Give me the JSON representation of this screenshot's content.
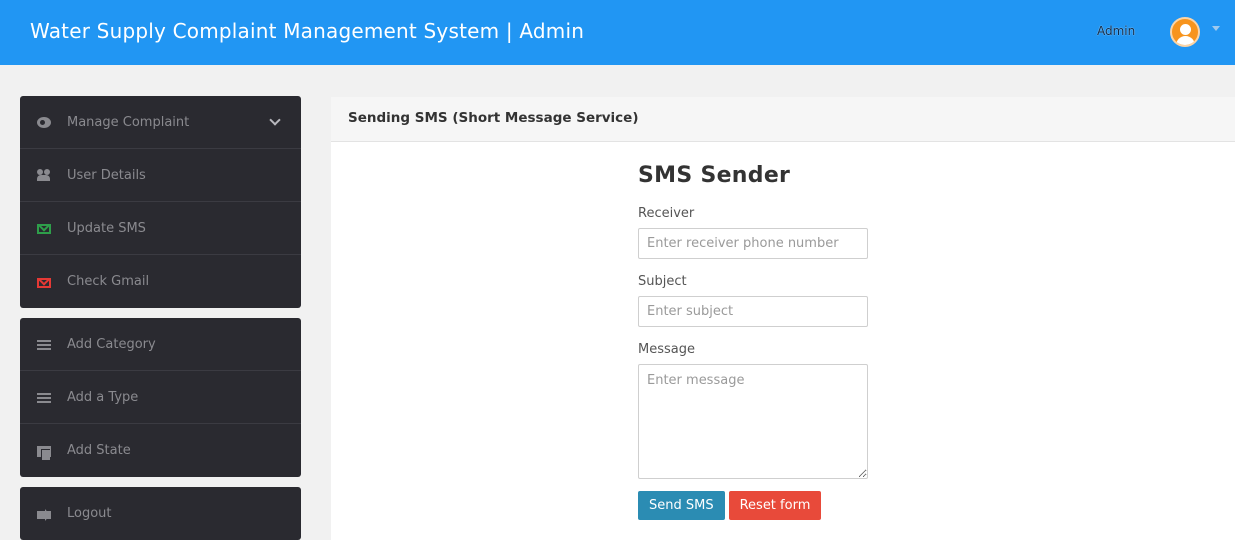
{
  "header": {
    "title": "Water Supply Complaint Management System | Admin",
    "user_label": "Admin"
  },
  "sidebar": {
    "groups": [
      {
        "items": [
          {
            "label": "Manage Complaint",
            "icon": "gear-icon",
            "has_dropdown": true
          },
          {
            "label": "User Details",
            "icon": "users-icon"
          },
          {
            "label": "Update SMS",
            "icon": "envelope-icon",
            "icon_color": "#2e9e4a"
          },
          {
            "label": "Check Gmail",
            "icon": "envelope-icon",
            "icon_color": "#e53935"
          }
        ]
      },
      {
        "items": [
          {
            "label": "Add Category",
            "icon": "list-icon"
          },
          {
            "label": "Add a Type",
            "icon": "list-icon"
          },
          {
            "label": "Add State",
            "icon": "copy-icon"
          }
        ]
      },
      {
        "items": [
          {
            "label": "Logout",
            "icon": "sign-out-icon"
          }
        ]
      }
    ]
  },
  "panel": {
    "heading": "Sending SMS (Short Message Service)"
  },
  "form": {
    "title": "SMS Sender",
    "receiver": {
      "label": "Receiver",
      "placeholder": "Enter receiver phone number",
      "value": ""
    },
    "subject": {
      "label": "Subject",
      "placeholder": "Enter subject",
      "value": ""
    },
    "message": {
      "label": "Message",
      "placeholder": "Enter message",
      "value": ""
    },
    "send_label": "Send SMS",
    "reset_label": "Reset form"
  },
  "colors": {
    "topbar": "#2196f3",
    "sidebar": "#2a2a30",
    "send_button": "#2b8cb3",
    "reset_button": "#e84a3a"
  }
}
